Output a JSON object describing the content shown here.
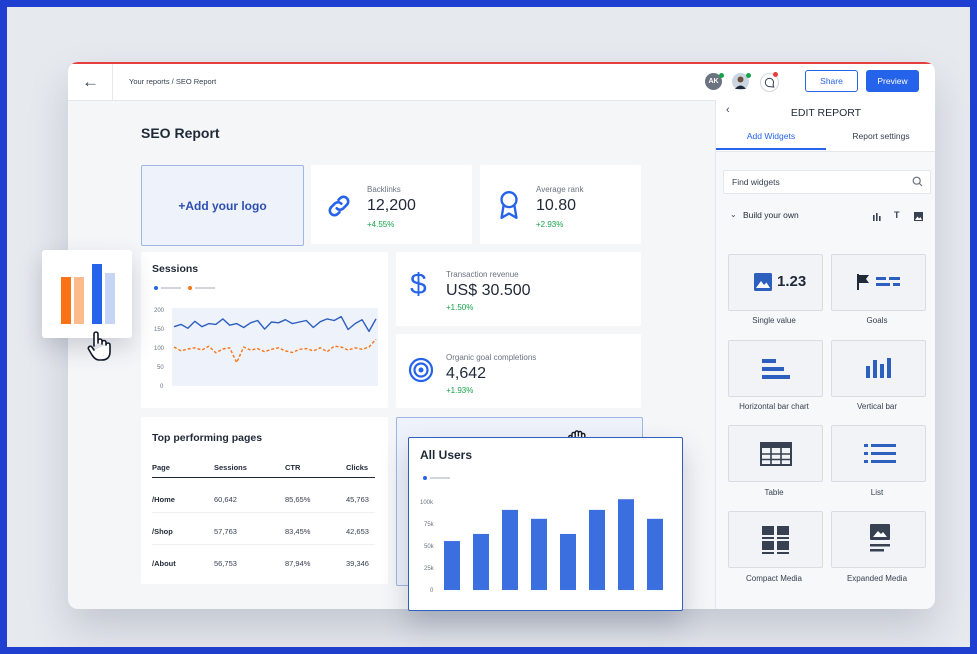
{
  "topbar": {
    "breadcrumb": "Your reports / SEO Report",
    "avatar_initials": "AK",
    "share_label": "Share",
    "preview_label": "Preview"
  },
  "report": {
    "title": "SEO Report",
    "logo_placeholder": "+Add your logo",
    "kpis": [
      {
        "label": "Backlinks",
        "value": "12,200",
        "delta": "+4.55%",
        "icon": "link-icon"
      },
      {
        "label": "Average rank",
        "value": "10.80",
        "delta": "+2.93%",
        "icon": "award-icon"
      },
      {
        "label": "Transaction revenue",
        "value": "US$ 30.500",
        "delta": "+1.50%",
        "icon": "dollar-icon"
      },
      {
        "label": "Organic goal completions",
        "value": "4,642",
        "delta": "+1.93%",
        "icon": "target-icon"
      }
    ],
    "sessions": {
      "title": "Sessions",
      "yticks": [
        "200",
        "150",
        "100",
        "50",
        "0"
      ]
    },
    "top_pages": {
      "title": "Top performing pages",
      "columns": [
        "Page",
        "Sessions",
        "CTR",
        "Clicks"
      ],
      "rows": [
        [
          "/Home",
          "60,642",
          "85,65%",
          "45,763"
        ],
        [
          "/Shop",
          "57,763",
          "83,45%",
          "42,653"
        ],
        [
          "/About",
          "56,753",
          "87,94%",
          "39,346"
        ]
      ]
    }
  },
  "all_users": {
    "title": "All Users",
    "yticks": [
      "100k",
      "75k",
      "50k",
      "25k",
      "0"
    ]
  },
  "panel": {
    "title": "EDIT REPORT",
    "tabs": [
      "Add Widgets",
      "Report settings"
    ],
    "search_placeholder": "Find widgets",
    "section": "Build your own",
    "single_value_sample": "1.23",
    "widgets": [
      "Single value",
      "Goals",
      "Horizontal bar chart",
      "Vertical bar",
      "Table",
      "List",
      "Compact Media",
      "Expanded Media"
    ]
  },
  "colors": {
    "accent": "#2563eb",
    "alert": "#e53e3e",
    "orange": "#f97316",
    "positive": "#16a34a"
  },
  "chart_data": [
    {
      "type": "line",
      "title": "Sessions",
      "ylim": [
        0,
        200
      ],
      "x": [
        1,
        2,
        3,
        4,
        5,
        6,
        7,
        8,
        9,
        10,
        11,
        12,
        13,
        14,
        15,
        16,
        17,
        18,
        19,
        20,
        21,
        22,
        23,
        24,
        25,
        26,
        27,
        28,
        29,
        30
      ],
      "series": [
        {
          "values": [
            152,
            158,
            148,
            166,
            152,
            160,
            158,
            172,
            156,
            160,
            150,
            162,
            168,
            146,
            164,
            162,
            170,
            160,
            164,
            168,
            150,
            165,
            172,
            168,
            178,
            145,
            160,
            170,
            140,
            172
          ]
        },
        {
          "values": [
            100,
            90,
            95,
            98,
            92,
            102,
            85,
            95,
            98,
            60,
            100,
            92,
            96,
            88,
            94,
            98,
            90,
            86,
            94,
            96,
            90,
            98,
            88,
            102,
            100,
            92,
            98,
            94,
            100,
            120
          ]
        }
      ]
    },
    {
      "type": "bar",
      "title": "All Users",
      "ylim": [
        0,
        100000
      ],
      "categories": [
        "1",
        "2",
        "3",
        "4",
        "5",
        "6",
        "7",
        "8"
      ],
      "values": [
        55000,
        63000,
        90000,
        80000,
        63000,
        90000,
        102000,
        80000
      ]
    }
  ]
}
